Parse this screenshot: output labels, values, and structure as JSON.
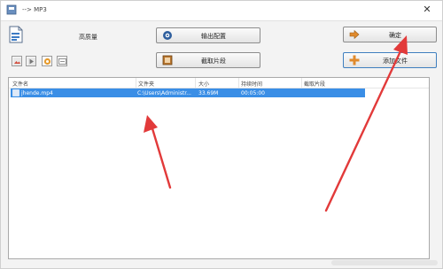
{
  "window": {
    "title": "--> MP3"
  },
  "header": {
    "quality_label": "高质量"
  },
  "buttons": {
    "output_config": "输出配置",
    "capture_segment": "截取片段",
    "ok": "确定",
    "add_file": "添加文件"
  },
  "table": {
    "columns": [
      "文件名",
      "文件夹",
      "大小",
      "持续时间",
      "截取片段"
    ],
    "rows": [
      {
        "file_name": "jhende.mp4",
        "folder": "C:\\Users\\Administr...",
        "size": "33.69M",
        "duration": "00:05:00",
        "segment": ""
      }
    ]
  },
  "colors": {
    "row_selected": "#3a8ee6",
    "arrow": "#e23a3a"
  }
}
